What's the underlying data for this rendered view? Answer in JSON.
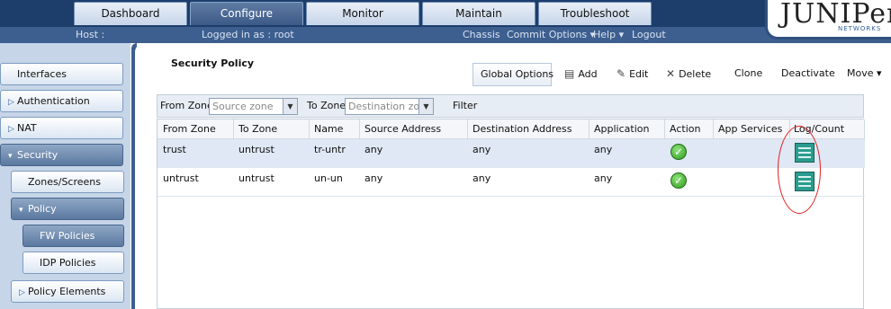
{
  "nav": {
    "tabs": [
      "Dashboard",
      "Configure",
      "Monitor",
      "Maintain",
      "Troubleshoot"
    ],
    "active": "Configure"
  },
  "subbar": {
    "host": "Host :",
    "logged_in": "Logged in as : root",
    "links": [
      "Chassis",
      "Commit Options ▾",
      "Help ▾",
      "Logout"
    ]
  },
  "brand": {
    "logo_text": "JUNIPer",
    "logo_sub": "NETWORKS"
  },
  "sidebar": {
    "items": [
      {
        "label": "Interfaces",
        "expand": ""
      },
      {
        "label": "Authentication",
        "expand": "▷"
      },
      {
        "label": "NAT",
        "expand": "▷"
      },
      {
        "label": "Security",
        "expand": "▾"
      },
      {
        "label": "Zones/Screens",
        "expand": ""
      },
      {
        "label": "Policy",
        "expand": "▾"
      },
      {
        "label": "FW Policies",
        "expand": ""
      },
      {
        "label": "IDP Policies",
        "expand": ""
      },
      {
        "label": "Policy Elements",
        "expand": "▷"
      }
    ]
  },
  "page": {
    "title": "Security Policy",
    "toolbar": {
      "global_options": "Global Options",
      "add": "Add",
      "edit": "Edit",
      "delete": "Delete",
      "clone": "Clone",
      "deactivate": "Deactivate",
      "move": "Move ▾"
    },
    "filter": {
      "from_zone_label": "From Zone",
      "from_zone_placeholder": "Source zone",
      "to_zone_label": "To Zone",
      "to_zone_placeholder": "Destination zon",
      "filter_label": "Filter"
    },
    "columns": [
      "From Zone",
      "To Zone",
      "Name",
      "Source Address",
      "Destination Address",
      "Application",
      "Action",
      "App Services",
      "Log/Count"
    ],
    "rows": [
      {
        "from_zone": "trust",
        "to_zone": "untrust",
        "name": "tr-untr",
        "source": "any",
        "destination": "any",
        "application": "any",
        "action": "permit-icon",
        "log": "log-count-icon"
      },
      {
        "from_zone": "untrust",
        "to_zone": "untrust",
        "name": "un-un",
        "source": "any",
        "destination": "any",
        "application": "any",
        "action": "permit-icon",
        "log": "log-count-icon"
      }
    ]
  }
}
